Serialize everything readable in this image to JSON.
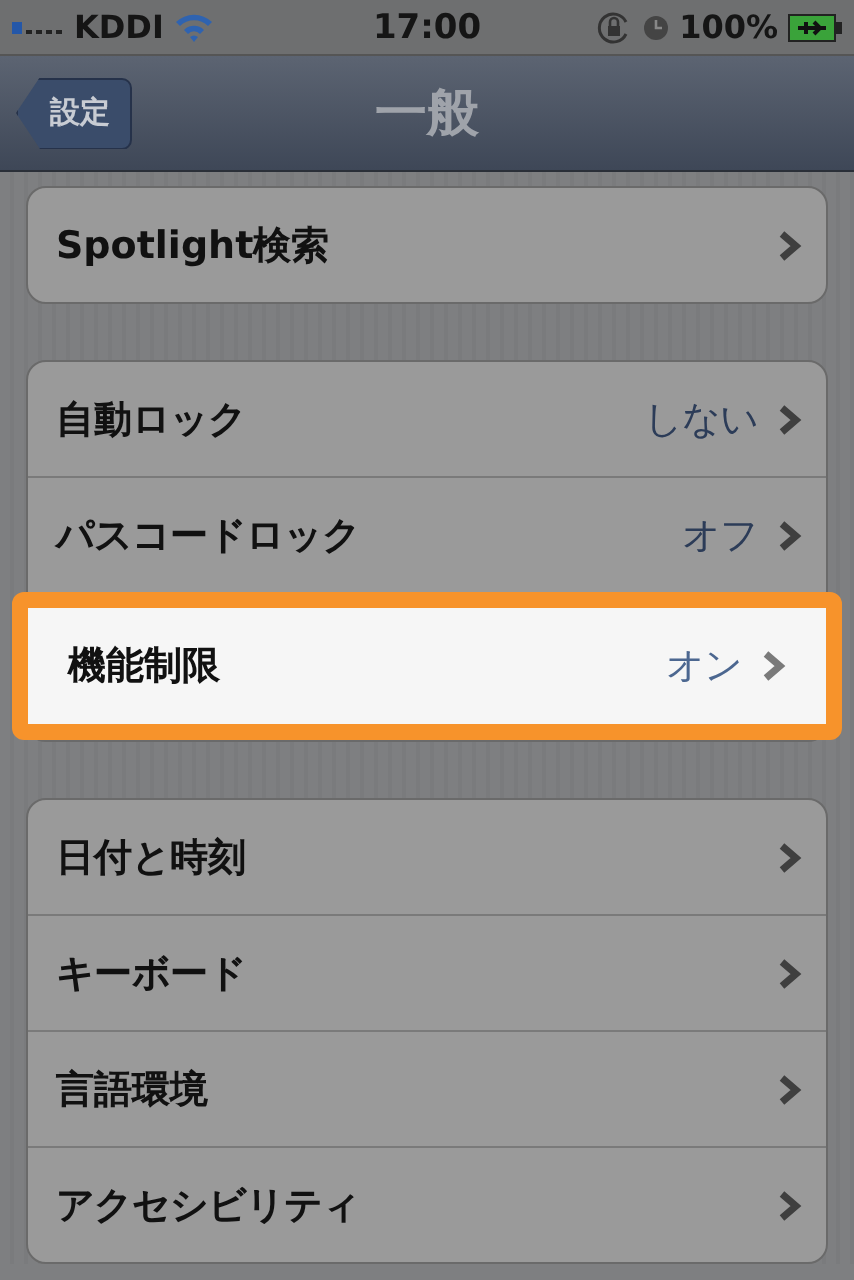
{
  "status_bar": {
    "carrier": "KDDI",
    "time": "17:00",
    "battery": "100%"
  },
  "nav_bar": {
    "back": "設定",
    "title": "一般"
  },
  "groups": [
    {
      "rows": [
        {
          "label": "Spotlight検索",
          "highlighted": false
        }
      ]
    },
    {
      "rows": [
        {
          "label": "自動ロック",
          "value": "しない",
          "highlighted": false
        },
        {
          "label": "パスコードロック",
          "value": "オフ",
          "highlighted": false
        },
        {
          "label": "機能制限",
          "value": "オン",
          "highlighted": true
        }
      ]
    },
    {
      "rows": [
        {
          "label": "日付と時刻",
          "highlighted": false
        },
        {
          "label": "キーボード",
          "highlighted": false
        },
        {
          "label": "言語環境",
          "highlighted": false
        },
        {
          "label": "アクセシビリティ",
          "highlighted": false
        }
      ]
    }
  ]
}
